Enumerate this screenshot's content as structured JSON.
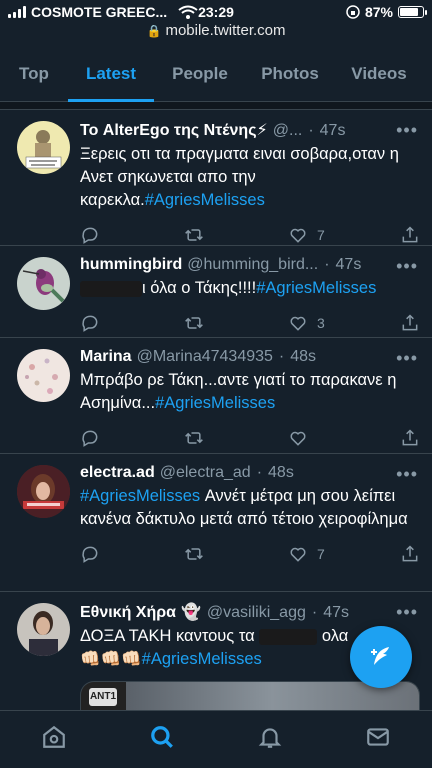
{
  "status": {
    "carrier": "COSMOTE GREEC...",
    "time": "23:29",
    "battery": "87%",
    "battery_level": 0.87,
    "url": "mobile.twitter.com"
  },
  "tabs": [
    {
      "label": "Top",
      "active": false
    },
    {
      "label": "Latest",
      "active": true
    },
    {
      "label": "People",
      "active": false
    },
    {
      "label": "Photos",
      "active": false
    },
    {
      "label": "Videos",
      "active": false
    }
  ],
  "tweets": [
    {
      "name": "Το AlterEgo της Ντένης⚡",
      "handle": "@...",
      "time": "47s",
      "text": "Ξερεις οτι τα πραγματα ειναι σοβαρα,οταν η Ανετ σηκωνεται απο την καρεκλα.",
      "hashtag": "#AgriesMelisses",
      "likes": "7",
      "avatar_text": "ΧΡΥΣΑ ΜΟΥ Η ΝΑΥΡΙΤΣΑ!!!"
    },
    {
      "name": "hummingbird",
      "handle": "@humming_bird...",
      "time": "47s",
      "text": "ι όλα ο Τάκης!!!!",
      "hashtag": "#AgriesMelisses",
      "likes": "3"
    },
    {
      "name": "Marina",
      "handle": "@Marina47434935",
      "time": "48s",
      "text": "Μπράβο ρε Τάκη...αντε γιατί το παρακανε η Ασημίνα...",
      "hashtag": "#AgriesMelisses",
      "likes": ""
    },
    {
      "name": "electra.ad",
      "handle": "@electra_ad",
      "time": "48s",
      "hashtag": "#AgriesMelisses",
      "text": " Αννέτ μέτρα μη σου λείπει κανένα δάκτυλο μετά από τέτοιο χειροφίλημα",
      "likes": "7"
    },
    {
      "name": "Εθνική Χήρα",
      "handle": "@vasiliki_agg",
      "time": "47s",
      "text_start": "ΔΟΞΑ ΤΑΚΗ καντους τα",
      "text_end": " ολα",
      "emojis": "👊🏻👊🏻👊🏻",
      "hashtag": "#AgriesMelisses",
      "media_logo": "ANT1"
    }
  ],
  "icons": {
    "reply": "reply-icon",
    "retweet": "retweet-icon",
    "like": "heart-icon",
    "share": "share-icon",
    "compose": "compose-tweet-icon",
    "nav": [
      "home-icon",
      "search-icon",
      "notifications-icon",
      "messages-icon"
    ]
  },
  "colors": {
    "background": "#15202b",
    "accent": "#1da1f2",
    "muted": "#8899a6",
    "divider": "#38444d"
  }
}
